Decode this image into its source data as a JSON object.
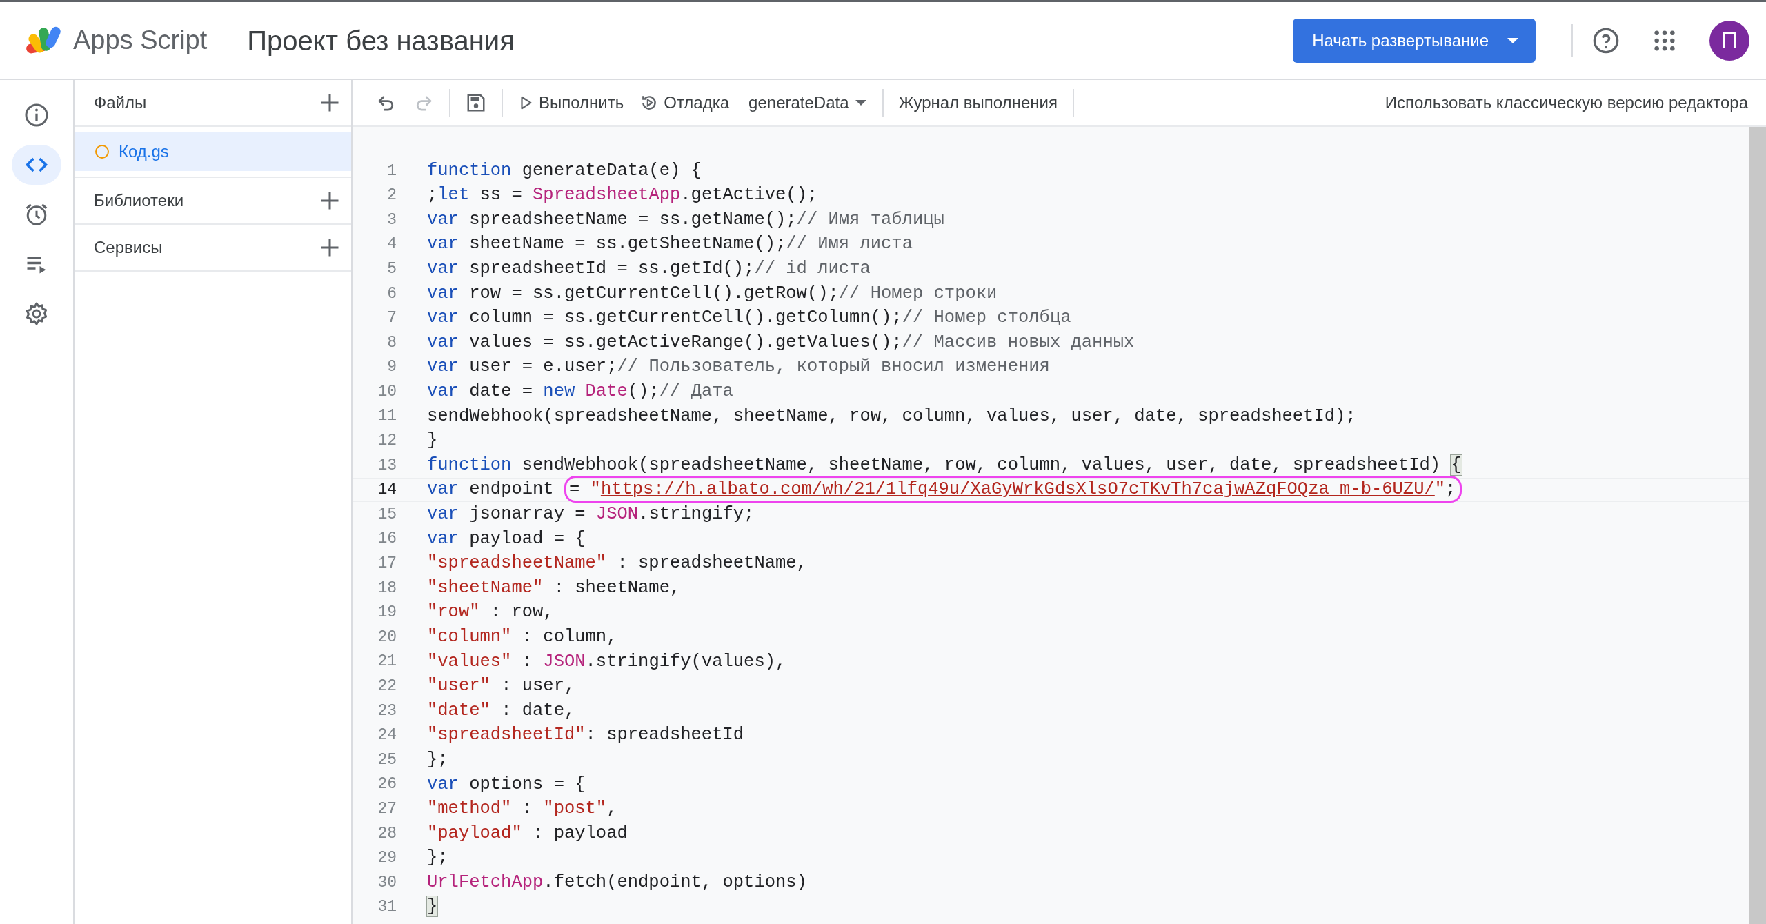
{
  "app": {
    "name": "Apps Script"
  },
  "project_title": "Проект без названия",
  "deploy_button": {
    "label": "Начать развертывание"
  },
  "avatar": {
    "letter": "П"
  },
  "rail": [
    {
      "kind": "info",
      "selected": false
    },
    {
      "kind": "code",
      "selected": true
    },
    {
      "kind": "triggers",
      "selected": false
    },
    {
      "kind": "executions",
      "selected": false
    },
    {
      "kind": "settings",
      "selected": false
    }
  ],
  "files_panel": {
    "sections": [
      {
        "title": "Файлы",
        "items": [
          {
            "name": "Код.gs",
            "selected": true
          }
        ]
      },
      {
        "title": "Библиотеки"
      },
      {
        "title": "Сервисы"
      }
    ]
  },
  "toolbar": {
    "undo": {
      "disabled": false
    },
    "redo": {
      "disabled": true
    },
    "run": "Выполнить",
    "debug": "Отладка",
    "function_select": "generateData",
    "log": "Журнал выполнения",
    "classic_link": "Использовать классическую версию редактора"
  },
  "editor": {
    "lines": [
      {
        "number": "1",
        "active": false,
        "tokens": [
          {
            "kind": "keyword",
            "text": "function"
          },
          {
            "kind": "plain",
            "text": " generateData(e) {"
          }
        ]
      },
      {
        "number": "2",
        "active": false,
        "tokens": [
          {
            "kind": "plain",
            "text": ";"
          },
          {
            "kind": "keyword",
            "text": "let"
          },
          {
            "kind": "plain",
            "text": " ss = "
          },
          {
            "kind": "class",
            "text": "SpreadsheetApp"
          },
          {
            "kind": "plain",
            "text": ".getActive();"
          }
        ]
      },
      {
        "number": "3",
        "active": false,
        "tokens": [
          {
            "kind": "keyword",
            "text": "var"
          },
          {
            "kind": "plain",
            "text": " spreadsheetName = ss.getName();"
          },
          {
            "kind": "comment",
            "text": "// Имя таблицы"
          }
        ]
      },
      {
        "number": "4",
        "active": false,
        "tokens": [
          {
            "kind": "keyword",
            "text": "var"
          },
          {
            "kind": "plain",
            "text": " sheetName = ss.getSheetName();"
          },
          {
            "kind": "comment",
            "text": "// Имя листа"
          }
        ]
      },
      {
        "number": "5",
        "active": false,
        "tokens": [
          {
            "kind": "keyword",
            "text": "var"
          },
          {
            "kind": "plain",
            "text": " spreadsheetId = ss.getId();"
          },
          {
            "kind": "comment",
            "text": "// id листа"
          }
        ]
      },
      {
        "number": "6",
        "active": false,
        "tokens": [
          {
            "kind": "keyword",
            "text": "var"
          },
          {
            "kind": "plain",
            "text": " row = ss.getCurrentCell().getRow();"
          },
          {
            "kind": "comment",
            "text": "// Номер строки"
          }
        ]
      },
      {
        "number": "7",
        "active": false,
        "tokens": [
          {
            "kind": "keyword",
            "text": "var"
          },
          {
            "kind": "plain",
            "text": " column = ss.getCurrentCell().getColumn();"
          },
          {
            "kind": "comment",
            "text": "// Номер столбца"
          }
        ]
      },
      {
        "number": "8",
        "active": false,
        "tokens": [
          {
            "kind": "keyword",
            "text": "var"
          },
          {
            "kind": "plain",
            "text": " values = ss.getActiveRange().getValues();"
          },
          {
            "kind": "comment",
            "text": "// Массив новых данных"
          }
        ]
      },
      {
        "number": "9",
        "active": false,
        "tokens": [
          {
            "kind": "keyword",
            "text": "var"
          },
          {
            "kind": "plain",
            "text": " user = e.user;"
          },
          {
            "kind": "comment",
            "text": "// Пользователь, который вносил изменения"
          }
        ]
      },
      {
        "number": "10",
        "active": false,
        "tokens": [
          {
            "kind": "keyword",
            "text": "var"
          },
          {
            "kind": "plain",
            "text": " date = "
          },
          {
            "kind": "keyword",
            "text": "new"
          },
          {
            "kind": "class",
            "text": " Date"
          },
          {
            "kind": "plain",
            "text": "();"
          },
          {
            "kind": "comment",
            "text": "// Дата"
          }
        ]
      },
      {
        "number": "11",
        "active": false,
        "tokens": [
          {
            "kind": "plain",
            "text": "sendWebhook(spreadsheetName, sheetName, row, column, values, user, date, spreadsheetId);"
          }
        ]
      },
      {
        "number": "12",
        "active": false,
        "tokens": [
          {
            "kind": "plain",
            "text": "}"
          }
        ]
      },
      {
        "number": "13",
        "active": false,
        "tokens": [
          {
            "kind": "keyword",
            "text": "function"
          },
          {
            "kind": "plain",
            "text": " sendWebhook(spreadsheetName, sheetName, row, column, values, user, date, spreadsheetId) "
          },
          {
            "kind": "bracket_match",
            "text": "{"
          }
        ]
      },
      {
        "number": "14",
        "active": true,
        "tokens": [
          {
            "kind": "keyword",
            "text": "var"
          },
          {
            "kind": "plain",
            "text": " endpoint "
          },
          {
            "kind": "plain",
            "text": "= ",
            "circled": true
          },
          {
            "kind": "string",
            "text": "\"",
            "circled": true
          },
          {
            "kind": "link",
            "text": "https://h.albato.com/wh/21/1lfq49u/XaGyWrkGdsXlsO7cTKvTh7cajwAZqFOQza_m-b-6UZU/",
            "circled": true
          },
          {
            "kind": "string",
            "text": "\"",
            "circled": true
          },
          {
            "kind": "plain",
            "text": ";",
            "circled": true
          }
        ]
      },
      {
        "number": "15",
        "active": false,
        "tokens": [
          {
            "kind": "keyword",
            "text": "var"
          },
          {
            "kind": "plain",
            "text": " jsonarray = "
          },
          {
            "kind": "class",
            "text": "JSON"
          },
          {
            "kind": "plain",
            "text": ".stringify;"
          }
        ]
      },
      {
        "number": "16",
        "active": false,
        "tokens": [
          {
            "kind": "keyword",
            "text": "var"
          },
          {
            "kind": "plain",
            "text": " payload = {"
          }
        ]
      },
      {
        "number": "17",
        "active": false,
        "tokens": [
          {
            "kind": "string",
            "text": "\"spreadsheetName\""
          },
          {
            "kind": "plain",
            "text": " : spreadsheetName,"
          }
        ]
      },
      {
        "number": "18",
        "active": false,
        "tokens": [
          {
            "kind": "string",
            "text": "\"sheetName\""
          },
          {
            "kind": "plain",
            "text": " : sheetName,"
          }
        ]
      },
      {
        "number": "19",
        "active": false,
        "tokens": [
          {
            "kind": "string",
            "text": "\"row\""
          },
          {
            "kind": "plain",
            "text": " : row,"
          }
        ]
      },
      {
        "number": "20",
        "active": false,
        "tokens": [
          {
            "kind": "string",
            "text": "\"column\""
          },
          {
            "kind": "plain",
            "text": " : column,"
          }
        ]
      },
      {
        "number": "21",
        "active": false,
        "tokens": [
          {
            "kind": "string",
            "text": "\"values\""
          },
          {
            "kind": "plain",
            "text": " : "
          },
          {
            "kind": "class",
            "text": "JSON"
          },
          {
            "kind": "plain",
            "text": ".stringify(values),"
          }
        ]
      },
      {
        "number": "22",
        "active": false,
        "tokens": [
          {
            "kind": "string",
            "text": "\"user\""
          },
          {
            "kind": "plain",
            "text": " : user,"
          }
        ]
      },
      {
        "number": "23",
        "active": false,
        "tokens": [
          {
            "kind": "string",
            "text": "\"date\""
          },
          {
            "kind": "plain",
            "text": " : date,"
          }
        ]
      },
      {
        "number": "24",
        "active": false,
        "tokens": [
          {
            "kind": "string",
            "text": "\"spreadsheetId\""
          },
          {
            "kind": "plain",
            "text": ": spreadsheetId"
          }
        ]
      },
      {
        "number": "25",
        "active": false,
        "tokens": [
          {
            "kind": "plain",
            "text": "};"
          }
        ]
      },
      {
        "number": "26",
        "active": false,
        "tokens": [
          {
            "kind": "keyword",
            "text": "var"
          },
          {
            "kind": "plain",
            "text": " options = {"
          }
        ]
      },
      {
        "number": "27",
        "active": false,
        "tokens": [
          {
            "kind": "string",
            "text": "\"method\""
          },
          {
            "kind": "plain",
            "text": " : "
          },
          {
            "kind": "string",
            "text": "\"post\""
          },
          {
            "kind": "plain",
            "text": ","
          }
        ]
      },
      {
        "number": "28",
        "active": false,
        "tokens": [
          {
            "kind": "string",
            "text": "\"payload\""
          },
          {
            "kind": "plain",
            "text": " : payload"
          }
        ]
      },
      {
        "number": "29",
        "active": false,
        "tokens": [
          {
            "kind": "plain",
            "text": "};"
          }
        ]
      },
      {
        "number": "30",
        "active": false,
        "tokens": [
          {
            "kind": "class",
            "text": "UrlFetchApp"
          },
          {
            "kind": "plain",
            "text": ".fetch(endpoint, options)"
          }
        ]
      },
      {
        "number": "31",
        "active": false,
        "tokens": [
          {
            "kind": "bracket_match",
            "text": "}"
          }
        ]
      }
    ]
  }
}
